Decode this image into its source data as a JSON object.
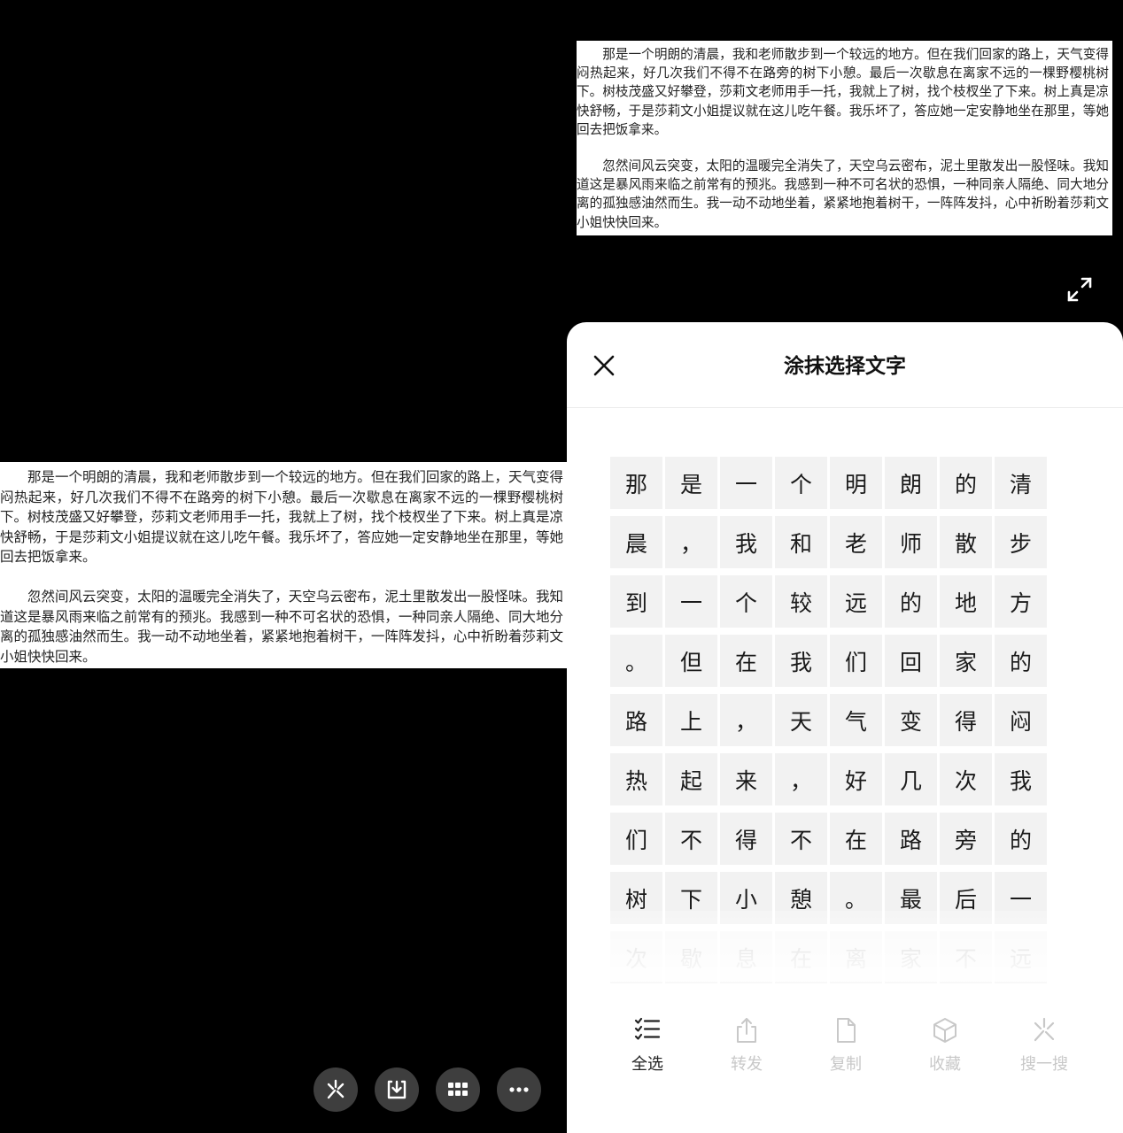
{
  "document": {
    "paragraph1": "那是一个明朗的清晨，我和老师散步到一个较远的地方。但在我们回家的路上，天气变得闷热起来，好几次我们不得不在路旁的树下小憩。最后一次歇息在离家不远的一棵野樱桃树下。树枝茂盛又好攀登，莎莉文老师用手一托，我就上了树，找个枝杈坐了下来。树上真是凉快舒畅，于是莎莉文小姐提议就在这儿吃午餐。我乐坏了，答应她一定安静地坐在那里，等她回去把饭拿来。",
    "paragraph2": "忽然间风云突变，太阳的温暖完全消失了，天空乌云密布，泥土里散发出一股怪味。我知道这是暴风雨来临之前常有的预兆。我感到一种不可名状的恐惧，一种同亲人隔绝、同大地分离的孤独感油然而生。我一动不动地坐着，紧紧地抱着树干，一阵阵发抖，心中祈盼着莎莉文小姐快快回来。"
  },
  "sheet": {
    "title": "涂抹选择文字",
    "chars": [
      "那",
      "是",
      "一",
      "个",
      "明",
      "朗",
      "的",
      "清",
      "晨",
      "，",
      "我",
      "和",
      "老",
      "师",
      "散",
      "步",
      "到",
      "一",
      "个",
      "较",
      "远",
      "的",
      "地",
      "方",
      "。",
      "但",
      "在",
      "我",
      "们",
      "回",
      "家",
      "的",
      "路",
      "上",
      "，",
      "天",
      "气",
      "变",
      "得",
      "闷",
      "热",
      "起",
      "来",
      "，",
      "好",
      "几",
      "次",
      "我",
      "们",
      "不",
      "得",
      "不",
      "在",
      "路",
      "旁",
      "的",
      "树",
      "下",
      "小",
      "憩",
      "。",
      "最",
      "后",
      "一",
      "次",
      "歇",
      "息",
      "在",
      "离",
      "家",
      "不",
      "远"
    ],
    "actions": [
      {
        "label": "全选",
        "icon": "select-all-icon",
        "enabled": true
      },
      {
        "label": "转发",
        "icon": "share-icon",
        "enabled": false
      },
      {
        "label": "复制",
        "icon": "copy-icon",
        "enabled": false
      },
      {
        "label": "收藏",
        "icon": "favorite-icon",
        "enabled": false
      },
      {
        "label": "搜一搜",
        "icon": "search-sparkle-icon",
        "enabled": false
      }
    ]
  },
  "toolbar": {
    "buttons": [
      {
        "icon": "search-sparkle-icon"
      },
      {
        "icon": "download-icon"
      },
      {
        "icon": "grid-icon"
      },
      {
        "icon": "more-icon"
      }
    ]
  },
  "colors": {
    "background": "#000000",
    "sheet": "#ffffff",
    "cell": "#f2f2f2",
    "disabled": "#c8c8c8",
    "toolbar_button": "#3e3e3e"
  }
}
